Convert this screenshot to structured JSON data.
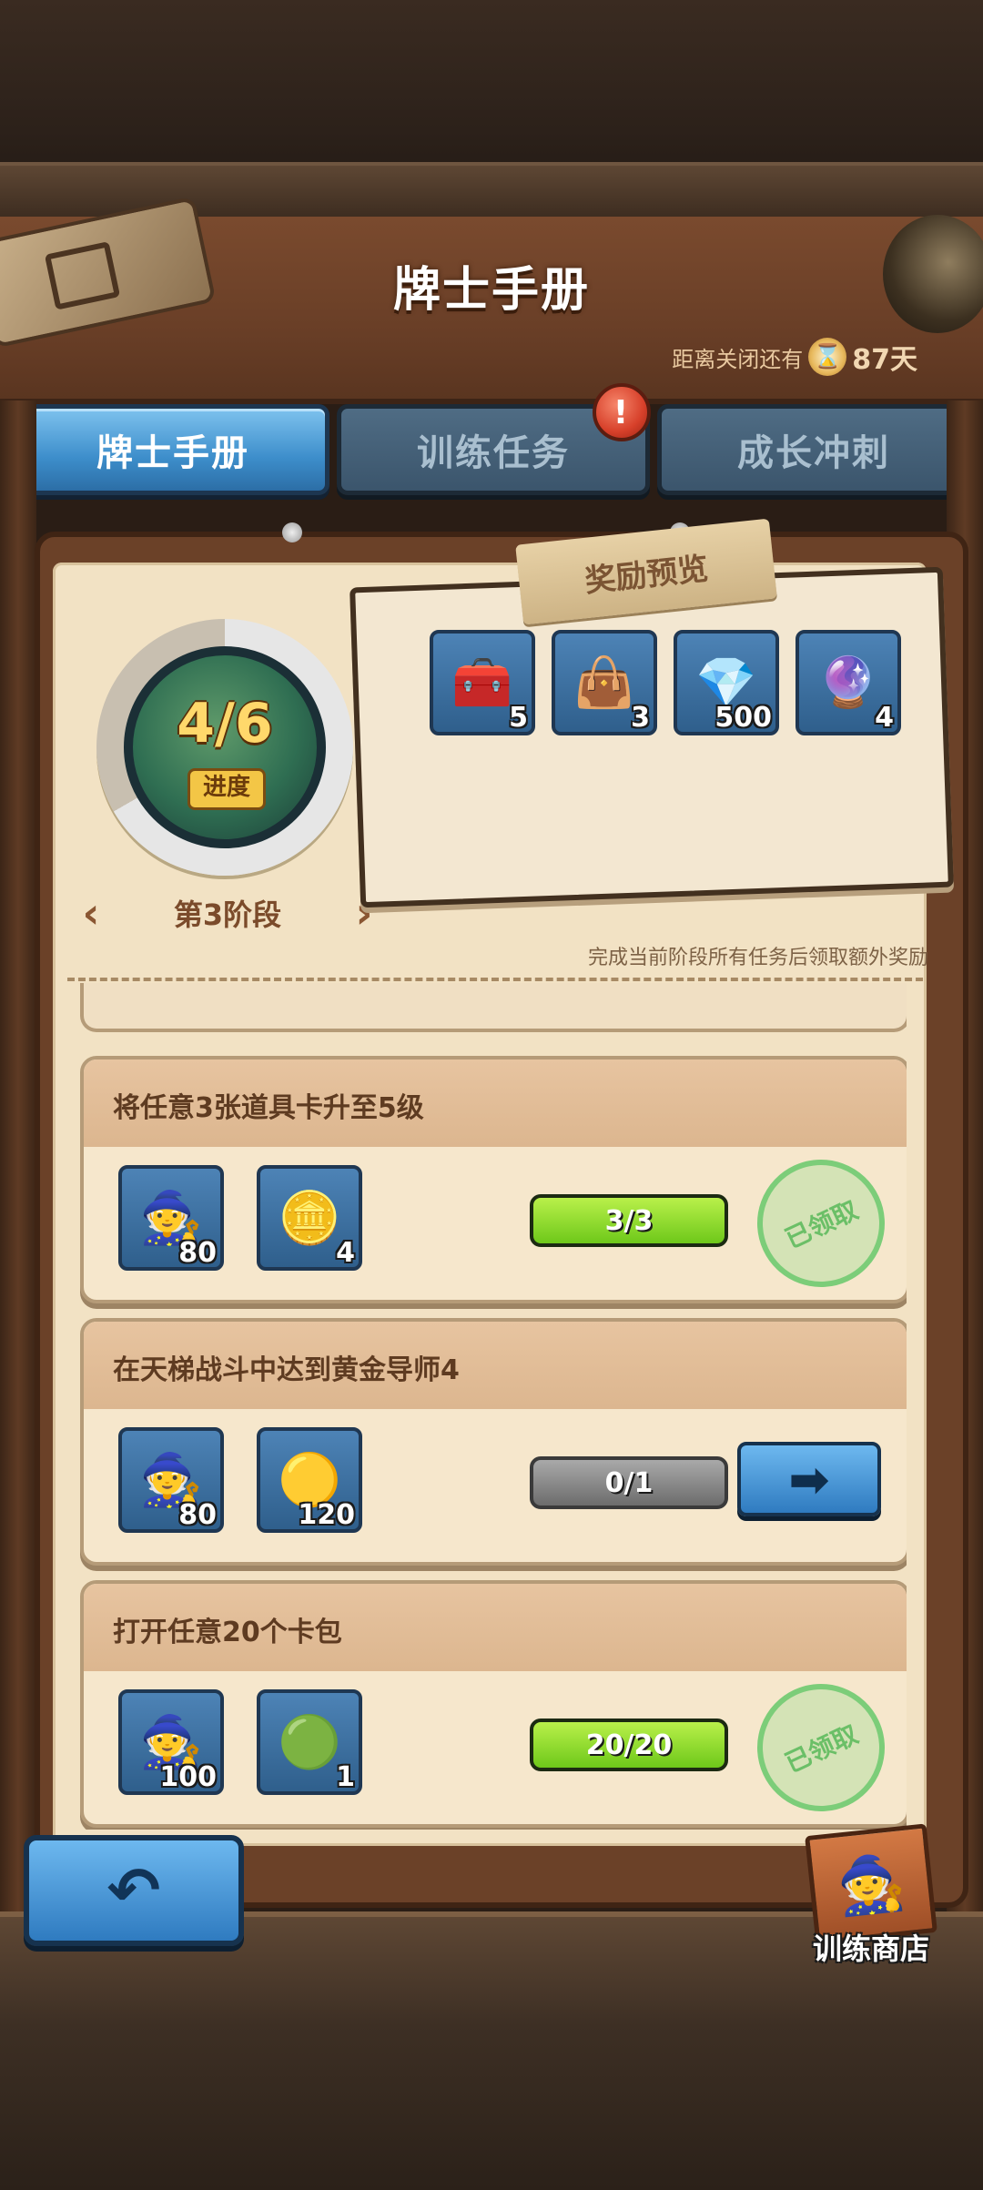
{
  "header": {
    "title": "牌士手册",
    "timer_label": "距离关闭还有",
    "timer_days": "87天"
  },
  "tabs": [
    {
      "label": "牌士手册",
      "active": true
    },
    {
      "label": "训练任务",
      "active": false,
      "badge": "!"
    },
    {
      "label": "成长冲刺",
      "active": false
    }
  ],
  "progress": {
    "value": "4/6",
    "label": "进度",
    "stage": "第3阶段",
    "fraction": 0.6667
  },
  "reward_preview": {
    "title": "奖励预览",
    "items": [
      {
        "icon": "bronze-chest-icon",
        "qty": "5"
      },
      {
        "icon": "purple-chest-icon",
        "qty": "3"
      },
      {
        "icon": "ruby-gem-icon",
        "qty": "500"
      },
      {
        "icon": "rainbow-orb-icon",
        "qty": "4"
      }
    ],
    "hint": "完成当前阶段所有任务后领取额外奖励"
  },
  "tasks": [
    {
      "title": "将任意3张道具卡升至5级",
      "rewards": [
        {
          "icon": "trainer-xp-icon",
          "qty": "80"
        },
        {
          "icon": "crystal-coin-icon",
          "qty": "4"
        }
      ],
      "progress_text": "3/3",
      "status": "claimed",
      "status_label": "已领取"
    },
    {
      "title": "在天梯战斗中达到黄金导师4",
      "rewards": [
        {
          "icon": "trainer-xp-icon",
          "qty": "80"
        },
        {
          "icon": "gold-coin-icon",
          "qty": "120"
        }
      ],
      "progress_text": "0/1",
      "status": "go",
      "status_label": "➡"
    },
    {
      "title": "打开任意20个卡包",
      "rewards": [
        {
          "icon": "trainer-xp-icon",
          "qty": "100"
        },
        {
          "icon": "green-emerald-icon",
          "qty": "1"
        }
      ],
      "progress_text": "20/20",
      "status": "claimed",
      "status_label": "已领取"
    }
  ],
  "footer": {
    "back_label": "↶",
    "shop_label": "训练商店"
  },
  "colors": {
    "accent_blue": "#3d8ecb",
    "progress_green": "#6ec81a",
    "panel_bg": "#f2e2c4"
  }
}
